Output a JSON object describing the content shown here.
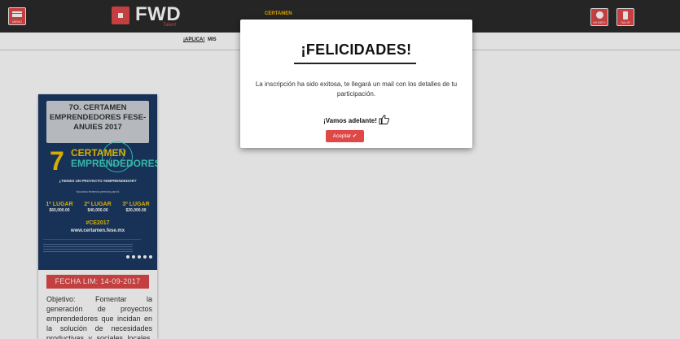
{
  "topbar": {
    "menu_label": "MENU",
    "brand": "FWD",
    "brand_sub": "Talent",
    "center_label": "CERTAMEN",
    "profile_label": "MI INFO",
    "exit_label": "SALIR"
  },
  "subnav": {
    "item_active": "¡APLICA!",
    "item_next": "MIS"
  },
  "card": {
    "poster_title": "7O. CERTAMEN EMPRENDEDORES FESE-ANUIES 2017",
    "poster_number": "7",
    "poster_word1": "CERTAMEN",
    "poster_word2": "EMPRENDEDORES",
    "poster_question": "¿TIENES UN PROYECTO #EMPRENDEDOR?",
    "poster_sub": "Nosotros tenemos premios para ti",
    "prizes": [
      {
        "place": "1º LUGAR",
        "amount": "$60,000.00"
      },
      {
        "place": "2º LUGAR",
        "amount": "$40,000.00"
      },
      {
        "place": "3º LUGAR",
        "amount": "$20,000.00"
      }
    ],
    "hashtag": "#CE2017",
    "url": "www.certamen.fese.mx",
    "date_label": "FECHA LIM: 14-09-2017",
    "objective": "Objetivo: Fomentar la generación de proyectos emprendedores que incidan en la solución de necesidades productivas y sociales locales, estatales y"
  },
  "modal": {
    "title": "¡FELICIDADES!",
    "body": "La inscripción ha sido exitosa, te llegará un mail con los detalles de tu participación.",
    "cheer": "¡Vamos adelante!",
    "accept_label": "Aceptar ✔"
  },
  "colors": {
    "accent": "#e04848",
    "topbar": "#2b2b2b",
    "poster_bg": "#1c3a63",
    "poster_yellow": "#f5c500"
  }
}
